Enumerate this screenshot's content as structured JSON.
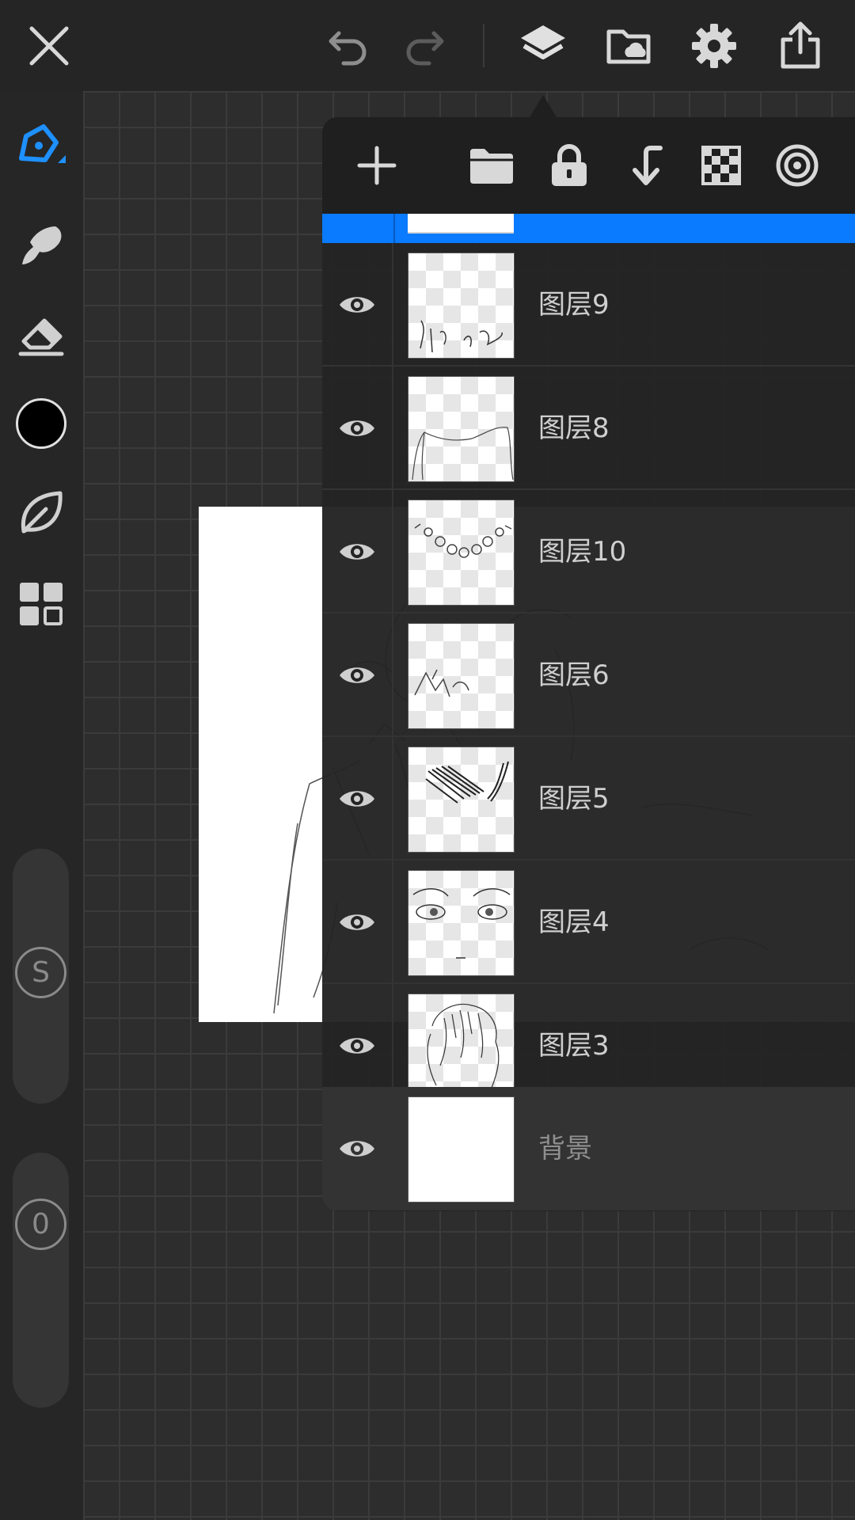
{
  "colors": {
    "accent": "#0a7aff",
    "current_color": "#000000"
  },
  "toolbar": {
    "icons": [
      "close-icon",
      "undo-icon",
      "redo-icon",
      "layers-icon",
      "cloud-folder-icon",
      "gear-icon",
      "share-icon"
    ]
  },
  "left_tools": {
    "icons": [
      "pen-icon",
      "smudge-icon",
      "eraser-icon",
      "color-swatch",
      "leaf-icon",
      "grid-icon"
    ],
    "size_slider_label": "S",
    "opacity_slider_label": "0"
  },
  "layers_panel": {
    "header_icons": [
      "add-icon",
      "folder-icon",
      "lock-icon",
      "merge-down-icon",
      "transparency-icon",
      "target-icon"
    ],
    "layers": [
      {
        "name": "图层9",
        "visible": true
      },
      {
        "name": "图层8",
        "visible": true
      },
      {
        "name": "图层10",
        "visible": true
      },
      {
        "name": "图层6",
        "visible": true
      },
      {
        "name": "图层5",
        "visible": true
      },
      {
        "name": "图层4",
        "visible": true
      },
      {
        "name": "图层3",
        "visible": true
      },
      {
        "name": "背景",
        "visible": true
      }
    ]
  }
}
